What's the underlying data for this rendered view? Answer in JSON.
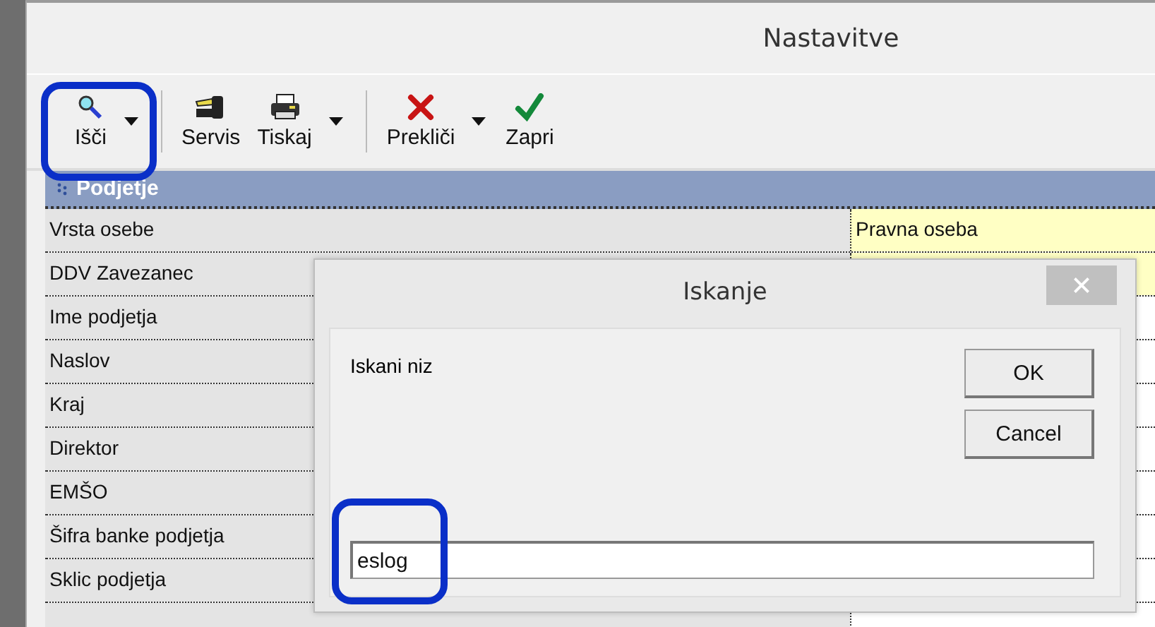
{
  "window": {
    "title": "Nastavitve"
  },
  "toolbar": [
    {
      "label": "Išči",
      "kind": "search",
      "dropdown": true,
      "separator_after": true
    },
    {
      "label": "Servis",
      "kind": "service",
      "dropdown": false,
      "separator_after": false
    },
    {
      "label": "Tiskaj",
      "kind": "print",
      "dropdown": true,
      "separator_after": true
    },
    {
      "label": "Prekliči",
      "kind": "cancel",
      "dropdown": true,
      "separator_after": false
    },
    {
      "label": "Zapri",
      "kind": "close",
      "dropdown": false,
      "separator_after": false
    }
  ],
  "section": {
    "title": "Podjetje"
  },
  "rows": [
    {
      "label": "Vrsta osebe",
      "value": "Pravna oseba",
      "highlighted": true
    },
    {
      "label": "DDV Zavezanec",
      "highlighted": true
    },
    {
      "label": "Ime podjetja",
      "highlighted": false
    },
    {
      "label": "Naslov",
      "highlighted": false
    },
    {
      "label": "Kraj",
      "highlighted": false
    },
    {
      "label": "Direktor",
      "highlighted": false
    },
    {
      "label": "EMŠO",
      "highlighted": false
    },
    {
      "label": "Šifra banke podjetja",
      "highlighted": false
    },
    {
      "label": "Sklic podjetja",
      "highlighted": false
    }
  ],
  "dialog": {
    "title": "Iskanje",
    "prompt": "Iskani niz",
    "buttons": [
      "OK",
      "Cancel"
    ],
    "input": {
      "value": "eslog"
    }
  }
}
